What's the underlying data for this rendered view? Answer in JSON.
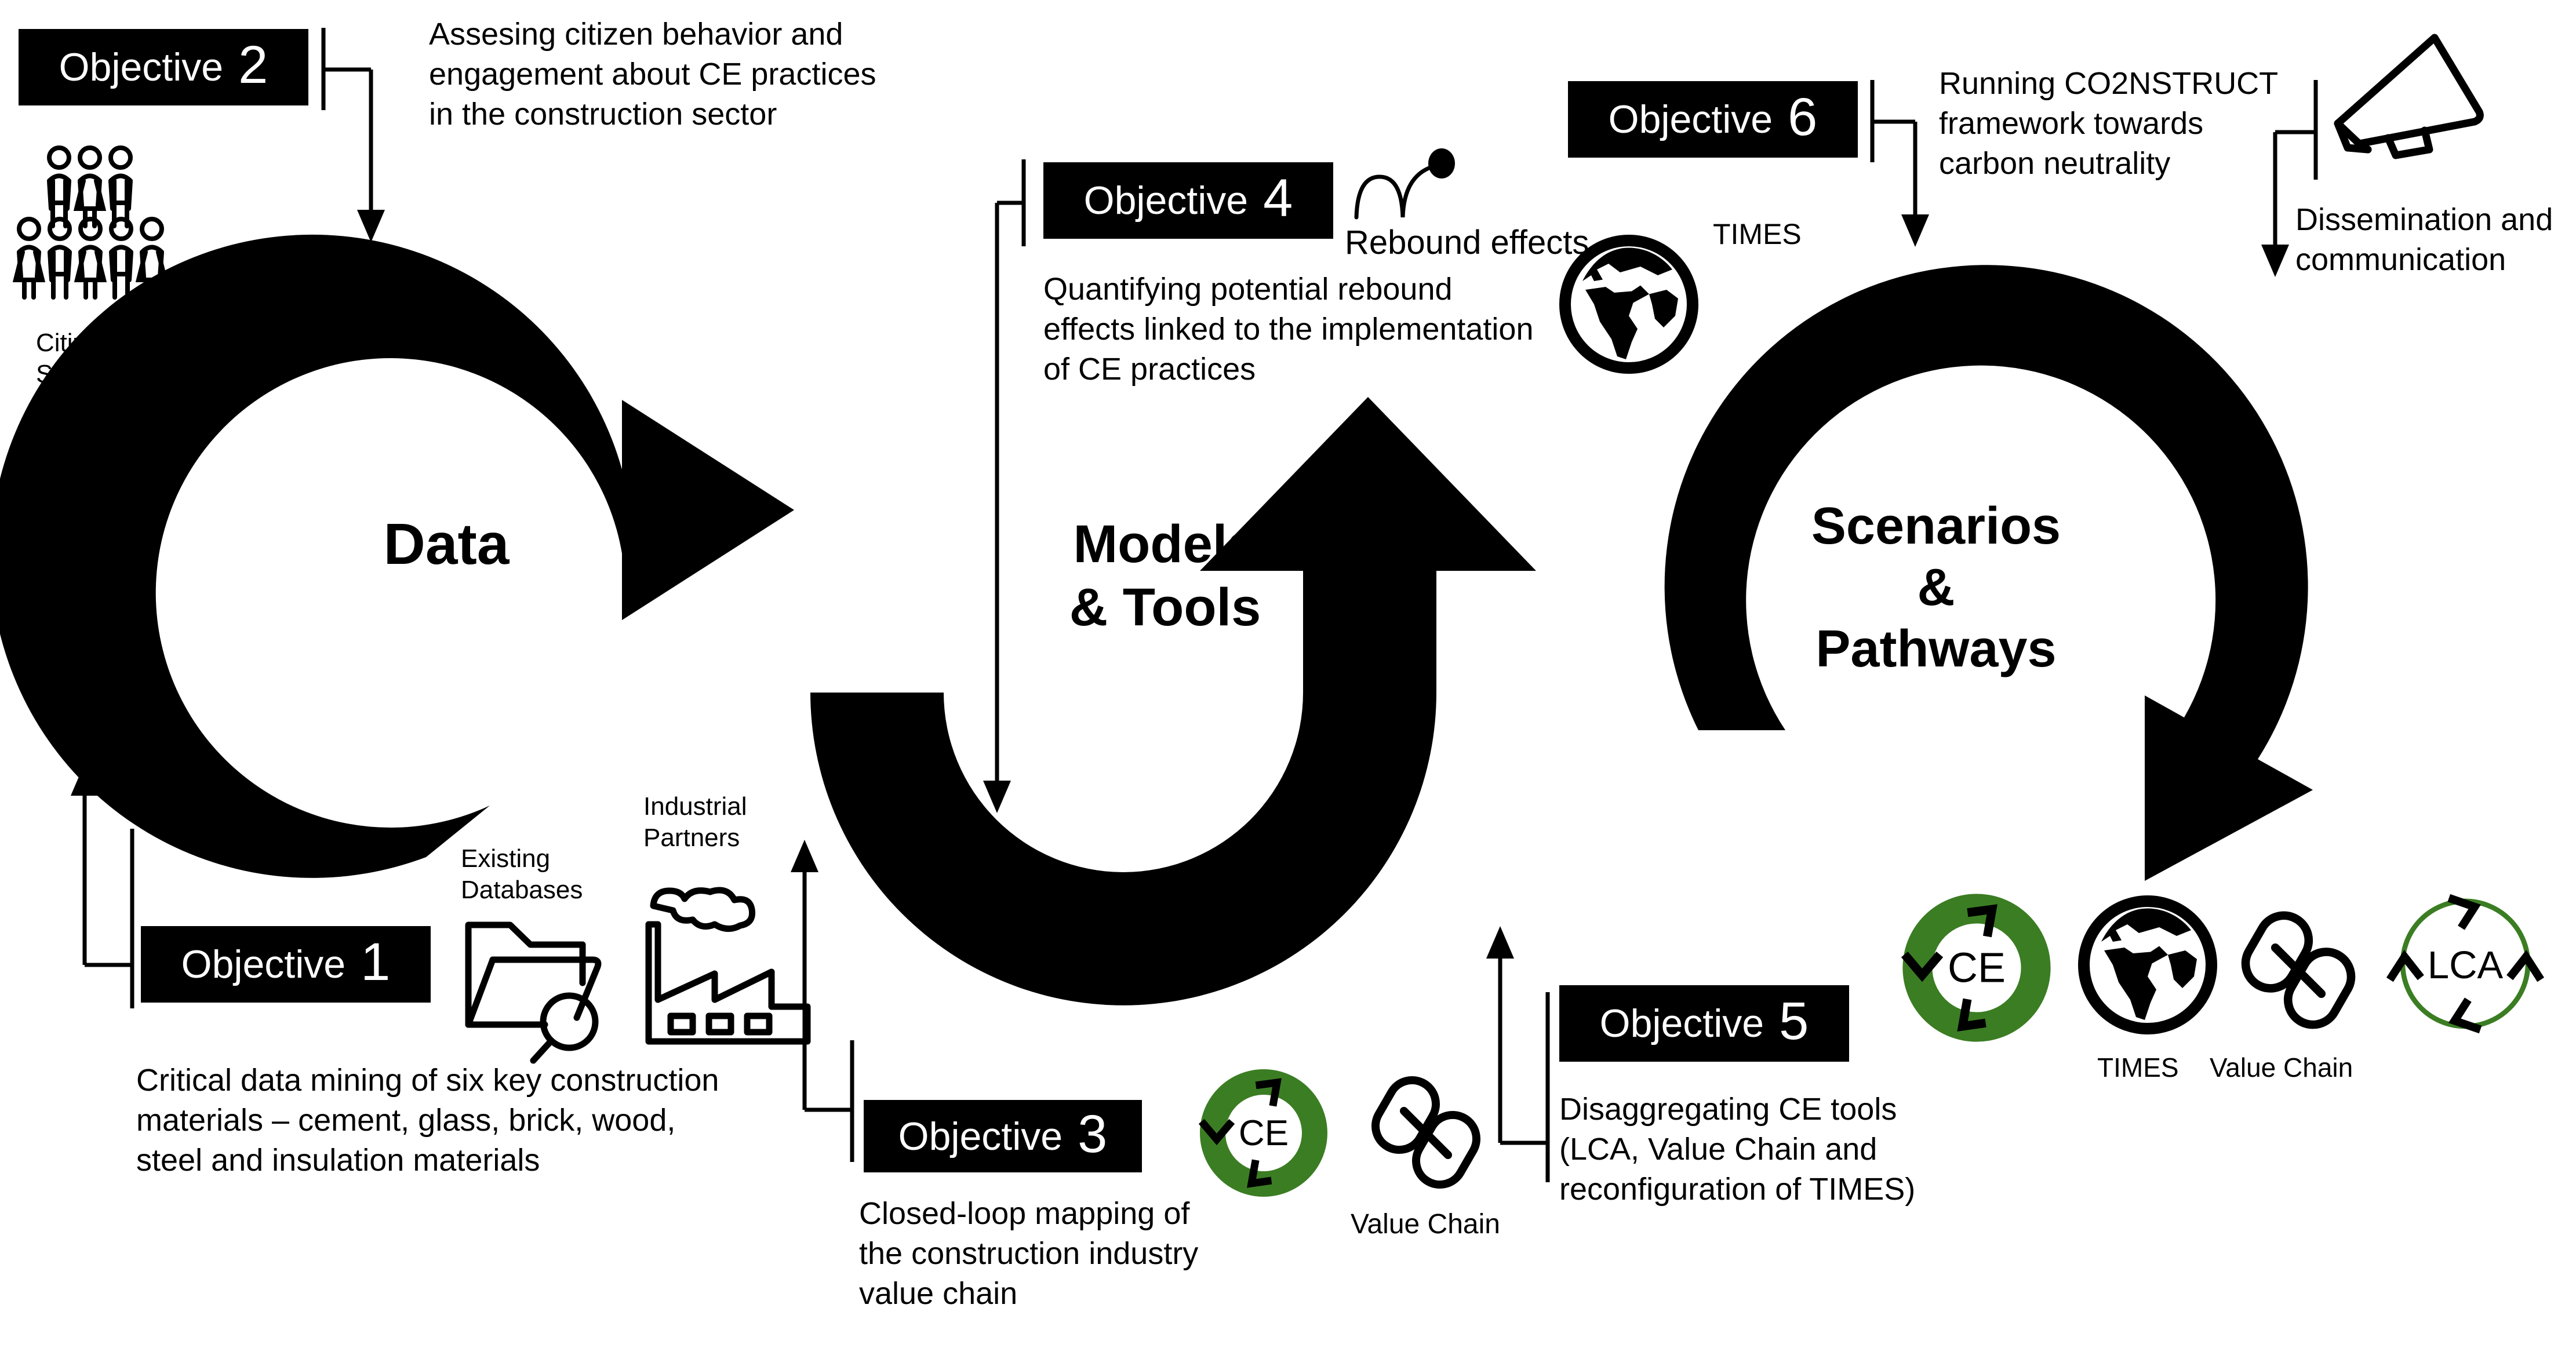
{
  "colors": {
    "black": "#000000",
    "white": "#ffffff",
    "green": "#3b7d23"
  },
  "cycles": [
    {
      "id": "data",
      "title": "Data"
    },
    {
      "id": "models",
      "title": "Models\n& Tools",
      "line1": "Models",
      "line2": "& Tools"
    },
    {
      "id": "scenarios",
      "title": "Scenarios & Pathways",
      "line1": "Scenarios",
      "line2": "&",
      "line3": "Pathways"
    }
  ],
  "objectives": [
    {
      "id": "objective-2",
      "word": "Objective",
      "number": "2",
      "description": "Assesing citizen behavior and engagement about CE practices in the construction sector"
    },
    {
      "id": "objective-4",
      "word": "Objective",
      "number": "4",
      "description": "Quantifying potential rebound effects linked to the implementation of CE practices"
    },
    {
      "id": "objective-6",
      "word": "Objective",
      "number": "6",
      "description": "Running CO2NSTRUCT framework towards carbon neutrality"
    },
    {
      "id": "objective-1",
      "word": "Objective",
      "number": "1",
      "description": "Critical data mining of six key construction materials – cement, glass, brick, wood, steel and insulation materials"
    },
    {
      "id": "objective-3",
      "word": "Objective",
      "number": "3",
      "description": "Closed-loop mapping of the construction industry value chain"
    },
    {
      "id": "objective-5",
      "word": "Objective",
      "number": "5",
      "description": "Disaggregating CE tools (LCA, Value Chain and reconfiguration of TIMES)"
    }
  ],
  "annotations": {
    "dissemination": "Dissemination and communication"
  },
  "icon_labels": {
    "citizen_survey": "Citizen\nSurvey",
    "citizen_survey_l1": "Citizen",
    "citizen_survey_l2": "Survey",
    "existing_databases_l1": "Existing",
    "existing_databases_l2": "Databases",
    "industrial_partners_l1": "Industrial",
    "industrial_partners_l2": "Partners",
    "rebound_effects": "Rebound effects",
    "times_top": "TIMES",
    "times_bottom": "TIMES",
    "value_chain_mid": "Value Chain",
    "value_chain_right": "Value Chain",
    "ce_ring_mid": "CE",
    "ce_ring_right": "CE",
    "lca_ring": "LCA"
  }
}
